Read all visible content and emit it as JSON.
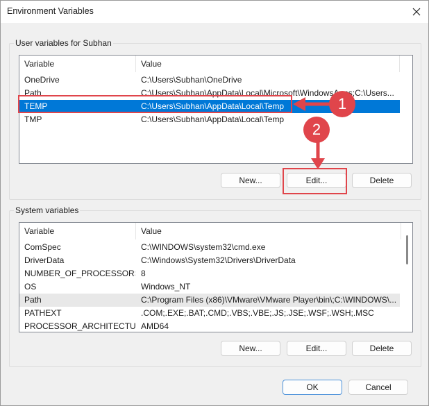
{
  "window": {
    "title": "Environment Variables",
    "close_icon": "close-icon"
  },
  "user_vars": {
    "group_label": "User variables for Subhan",
    "col_variable": "Variable",
    "col_value": "Value",
    "rows": [
      {
        "variable": "OneDrive",
        "value": "C:\\Users\\Subhan\\OneDrive"
      },
      {
        "variable": "Path",
        "value": "C:\\Users\\Subhan\\AppData\\Local\\Microsoft\\WindowsApps;C:\\Users..."
      },
      {
        "variable": "TEMP",
        "value": "C:\\Users\\Subhan\\AppData\\Local\\Temp"
      },
      {
        "variable": "TMP",
        "value": "C:\\Users\\Subhan\\AppData\\Local\\Temp"
      }
    ],
    "new_label": "New...",
    "edit_label": "Edit...",
    "delete_label": "Delete"
  },
  "system_vars": {
    "group_label": "System variables",
    "col_variable": "Variable",
    "col_value": "Value",
    "rows": [
      {
        "variable": "ComSpec",
        "value": "C:\\WINDOWS\\system32\\cmd.exe"
      },
      {
        "variable": "DriverData",
        "value": "C:\\Windows\\System32\\Drivers\\DriverData"
      },
      {
        "variable": "NUMBER_OF_PROCESSORS",
        "value": "8"
      },
      {
        "variable": "OS",
        "value": "Windows_NT"
      },
      {
        "variable": "Path",
        "value": "C:\\Program Files (x86)\\VMware\\VMware Player\\bin\\;C:\\WINDOWS\\..."
      },
      {
        "variable": "PATHEXT",
        "value": ".COM;.EXE;.BAT;.CMD;.VBS;.VBE;.JS;.JSE;.WSF;.WSH;.MSC"
      },
      {
        "variable": "PROCESSOR_ARCHITECTURE",
        "value": "AMD64"
      }
    ],
    "new_label": "New...",
    "edit_label": "Edit...",
    "delete_label": "Delete"
  },
  "dialog": {
    "ok_label": "OK",
    "cancel_label": "Cancel"
  },
  "annotations": {
    "step1": "1",
    "step2": "2",
    "color": "#e0454b"
  },
  "colors": {
    "selection": "#0078d7",
    "annotation_red": "#e0454b"
  }
}
